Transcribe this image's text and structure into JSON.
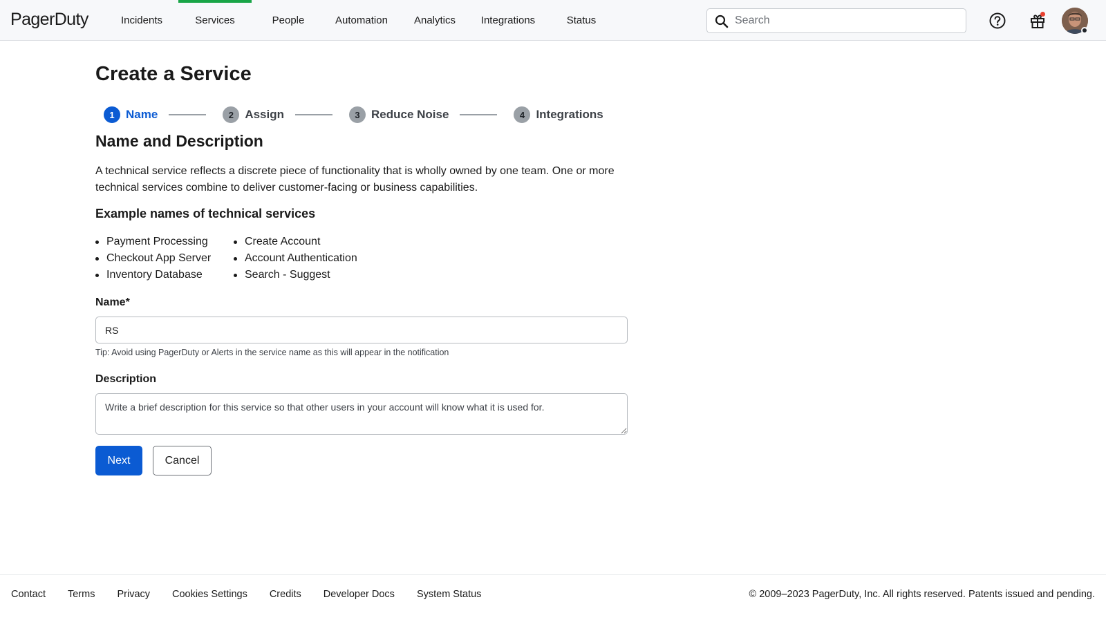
{
  "header": {
    "logo": "PagerDuty",
    "nav": [
      {
        "label": "Incidents",
        "active": false
      },
      {
        "label": "Services",
        "active": true
      },
      {
        "label": "People",
        "active": false
      },
      {
        "label": "Automation",
        "active": false
      },
      {
        "label": "Analytics",
        "active": false
      },
      {
        "label": "Integrations",
        "active": false
      },
      {
        "label": "Status",
        "active": false
      }
    ],
    "search_placeholder": "Search",
    "icons": [
      "search-icon",
      "help-icon",
      "gift-icon",
      "avatar"
    ],
    "accent_color": "#19a547"
  },
  "page": {
    "title": "Create a Service",
    "steps": [
      {
        "number": "1",
        "label": "Name",
        "active": true
      },
      {
        "number": "2",
        "label": "Assign",
        "active": false
      },
      {
        "number": "3",
        "label": "Reduce Noise",
        "active": false
      },
      {
        "number": "4",
        "label": "Integrations",
        "active": false
      }
    ],
    "section_title": "Name and Description",
    "description": "A technical service reflects a discrete piece of functionality that is wholly owned by one team. One or more technical services combine to deliver customer-facing or business capabilities.",
    "examples_title": "Example names of technical services",
    "examples_col1": [
      "Payment Processing",
      "Checkout App Server",
      "Inventory Database"
    ],
    "examples_col2": [
      "Create Account",
      "Account Authentication",
      "Search - Suggest"
    ],
    "name_label": "Name*",
    "name_value": "RS",
    "name_tip": "Tip: Avoid using PagerDuty or Alerts in the service name as this will appear in the notification",
    "description_label": "Description",
    "description_placeholder": "Write a brief description for this service so that other users in your account will know what it is used for.",
    "next_label": "Next",
    "cancel_label": "Cancel",
    "primary_color": "#0b5bd3"
  },
  "footer": {
    "links": [
      "Contact",
      "Terms",
      "Privacy",
      "Cookies Settings",
      "Credits",
      "Developer Docs",
      "System Status"
    ],
    "copyright": "© 2009–2023 PagerDuty, Inc. All rights reserved. Patents issued and pending."
  }
}
